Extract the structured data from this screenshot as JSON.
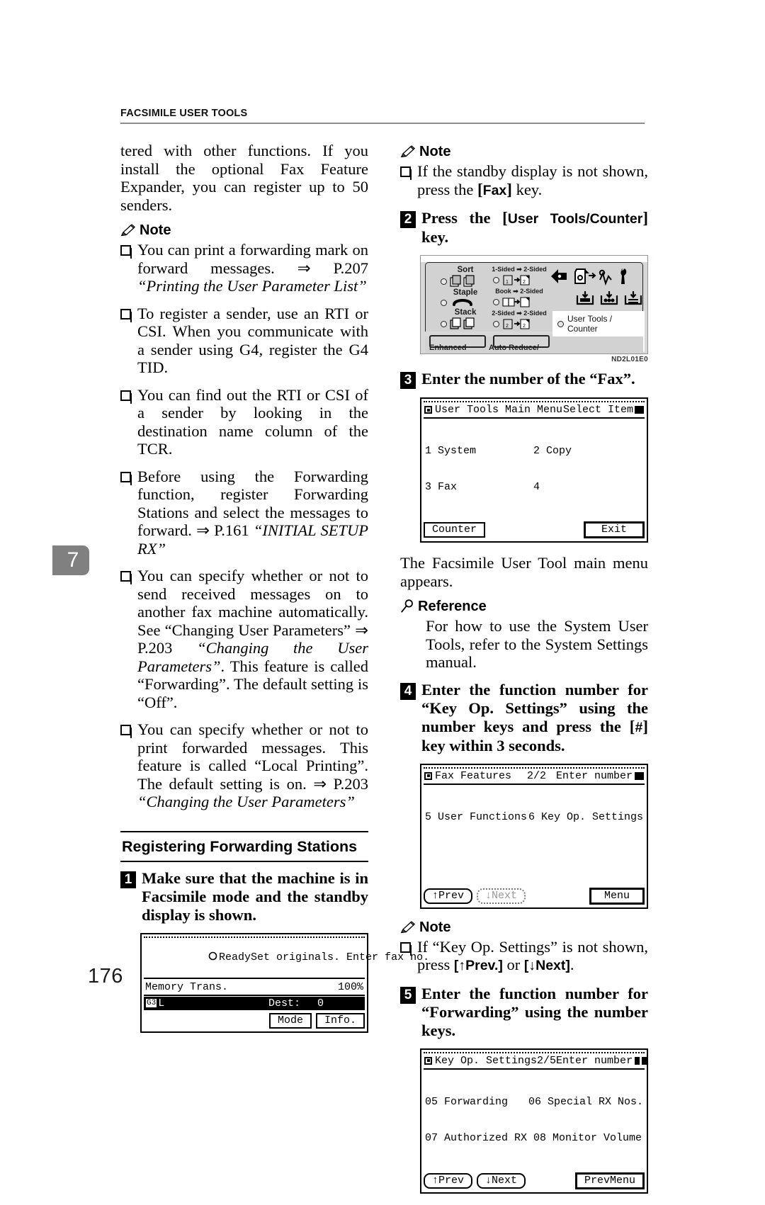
{
  "header": {
    "title": "FACSIMILE USER TOOLS"
  },
  "chapter_tab": {
    "number": "7"
  },
  "page_number": "176",
  "left_column": {
    "continued_paragraph": "tered with other functions. If you install the optional Fax Feature Expander, you can register up to 50 senders.",
    "note_heading": "Note",
    "note_items": [
      {
        "text": "You can print a forwarding mark on forward messages. ⇒ P.207 ",
        "italic_tail": "“Printing the User Parameter List”"
      },
      {
        "text": "To register a sender, use an RTI or CSI. When you communicate with a sender using G4, register the G4 TID.",
        "italic_tail": ""
      },
      {
        "text": "You can find out the RTI or CSI of a sender by looking in the destination name column of the TCR.",
        "italic_tail": ""
      },
      {
        "text": "Before using the Forwarding function, register Forwarding Stations and select the messages to forward. ⇒ P.161 ",
        "italic_tail": "“INITIAL SETUP RX”"
      },
      {
        "text": "You can specify whether or not to send received messages on to another fax machine automatically. See “Changing User Parameters” ⇒ P.203 ",
        "italic_mid": "“Changing the User Parameters”",
        "text_tail": ". This feature is called “Forwarding”. The default setting is “Off”.",
        "italic_tail": ""
      },
      {
        "text": "You can specify whether or not to print forwarded messages. This feature is called “Local Printing”. The default setting is on. ⇒ P.203 ",
        "italic_tail": "“Changing the User Parameters”"
      }
    ],
    "section_heading": "Registering Forwarding Stations",
    "step1": {
      "number": "1",
      "text": "Make sure that the machine is in Facsimile mode and the standby display is shown."
    },
    "standby_lcd": {
      "status": "Ready",
      "prompt": "Set originals. Enter fax no.",
      "mode_line": "Memory Trans.",
      "memory_pct": "100%",
      "line_indicator": "G3",
      "line_suffix": "L",
      "dest_label": "Dest:",
      "dest_value": "0",
      "button_mode": "Mode",
      "button_info": "Info."
    }
  },
  "right_column": {
    "note1_heading": "Note",
    "note1_item_pre": "If the standby display is not shown, press the ",
    "note1_key": "Fax",
    "note1_item_post": " key.",
    "step2": {
      "number": "2",
      "text_pre": "Press the ",
      "key": "User Tools/Counter",
      "text_post": " key."
    },
    "control_panel": {
      "labels": {
        "sort": "Sort",
        "staple": "Staple",
        "stack": "Stack",
        "one_to_two": "1-Sided ➡ 2-Sided",
        "book_to_two": "Book ➡ 2-Sided",
        "two_to_two": "2-Sided ➡ 2-Sided",
        "user_tools_counter": "User Tools / Counter",
        "enhanced": "Enhanced",
        "auto_reduce": "Auto Reduce/"
      },
      "figure_code": "ND2L01E0"
    },
    "step3": {
      "number": "3",
      "text": "Enter the number of the “Fax”."
    },
    "main_menu_lcd": {
      "title": "User Tools Main Menu",
      "hint": "Select Item",
      "items": [
        {
          "num": "1",
          "label": "System"
        },
        {
          "num": "2",
          "label": "Copy"
        },
        {
          "num": "3",
          "label": "Fax"
        },
        {
          "num": "4",
          "label": ""
        }
      ],
      "button_counter": "Counter",
      "button_exit": "Exit"
    },
    "after_step3_text": "The Facsimile User Tool main menu appears.",
    "reference_heading": "Reference",
    "reference_text": "For how to use the System User Tools, refer to the System Settings manual.",
    "step4": {
      "number": "4",
      "text_pre": "Enter the function number for “Key Op. Settings” using the number keys and press the ",
      "key": "#",
      "text_post": " key within 3 seconds."
    },
    "fax_features_lcd": {
      "title": "Fax Features",
      "page": "2/2",
      "hint": "Enter number",
      "items": [
        {
          "num": "5",
          "label": "User Functions"
        },
        {
          "num": "6",
          "label": "Key Op. Settings"
        }
      ],
      "button_prev": "↑Prev",
      "button_next": "↓Next",
      "button_menu": "Menu"
    },
    "note2_heading": "Note",
    "note2_pre": "If “Key Op. Settings” is not shown, press ",
    "note2_key1": "[↑Prev.]",
    "note2_mid": " or ",
    "note2_key2": "[↓Next]",
    "note2_post": ".",
    "step5": {
      "number": "5",
      "text": "Enter the function number for “Forwarding” using the number keys."
    },
    "key_op_lcd": {
      "title": "Key Op. Settings",
      "page": "2/5",
      "hint": "Enter number",
      "items": [
        {
          "num": "05",
          "label": "Forwarding"
        },
        {
          "num": "06",
          "label": "Special RX Nos."
        },
        {
          "num": "07",
          "label": "Authorized RX"
        },
        {
          "num": "08",
          "label": "Monitor Volume"
        }
      ],
      "button_prev": "↑Prev",
      "button_next": "↓Next",
      "button_prevmenu": "PrevMenu"
    }
  }
}
